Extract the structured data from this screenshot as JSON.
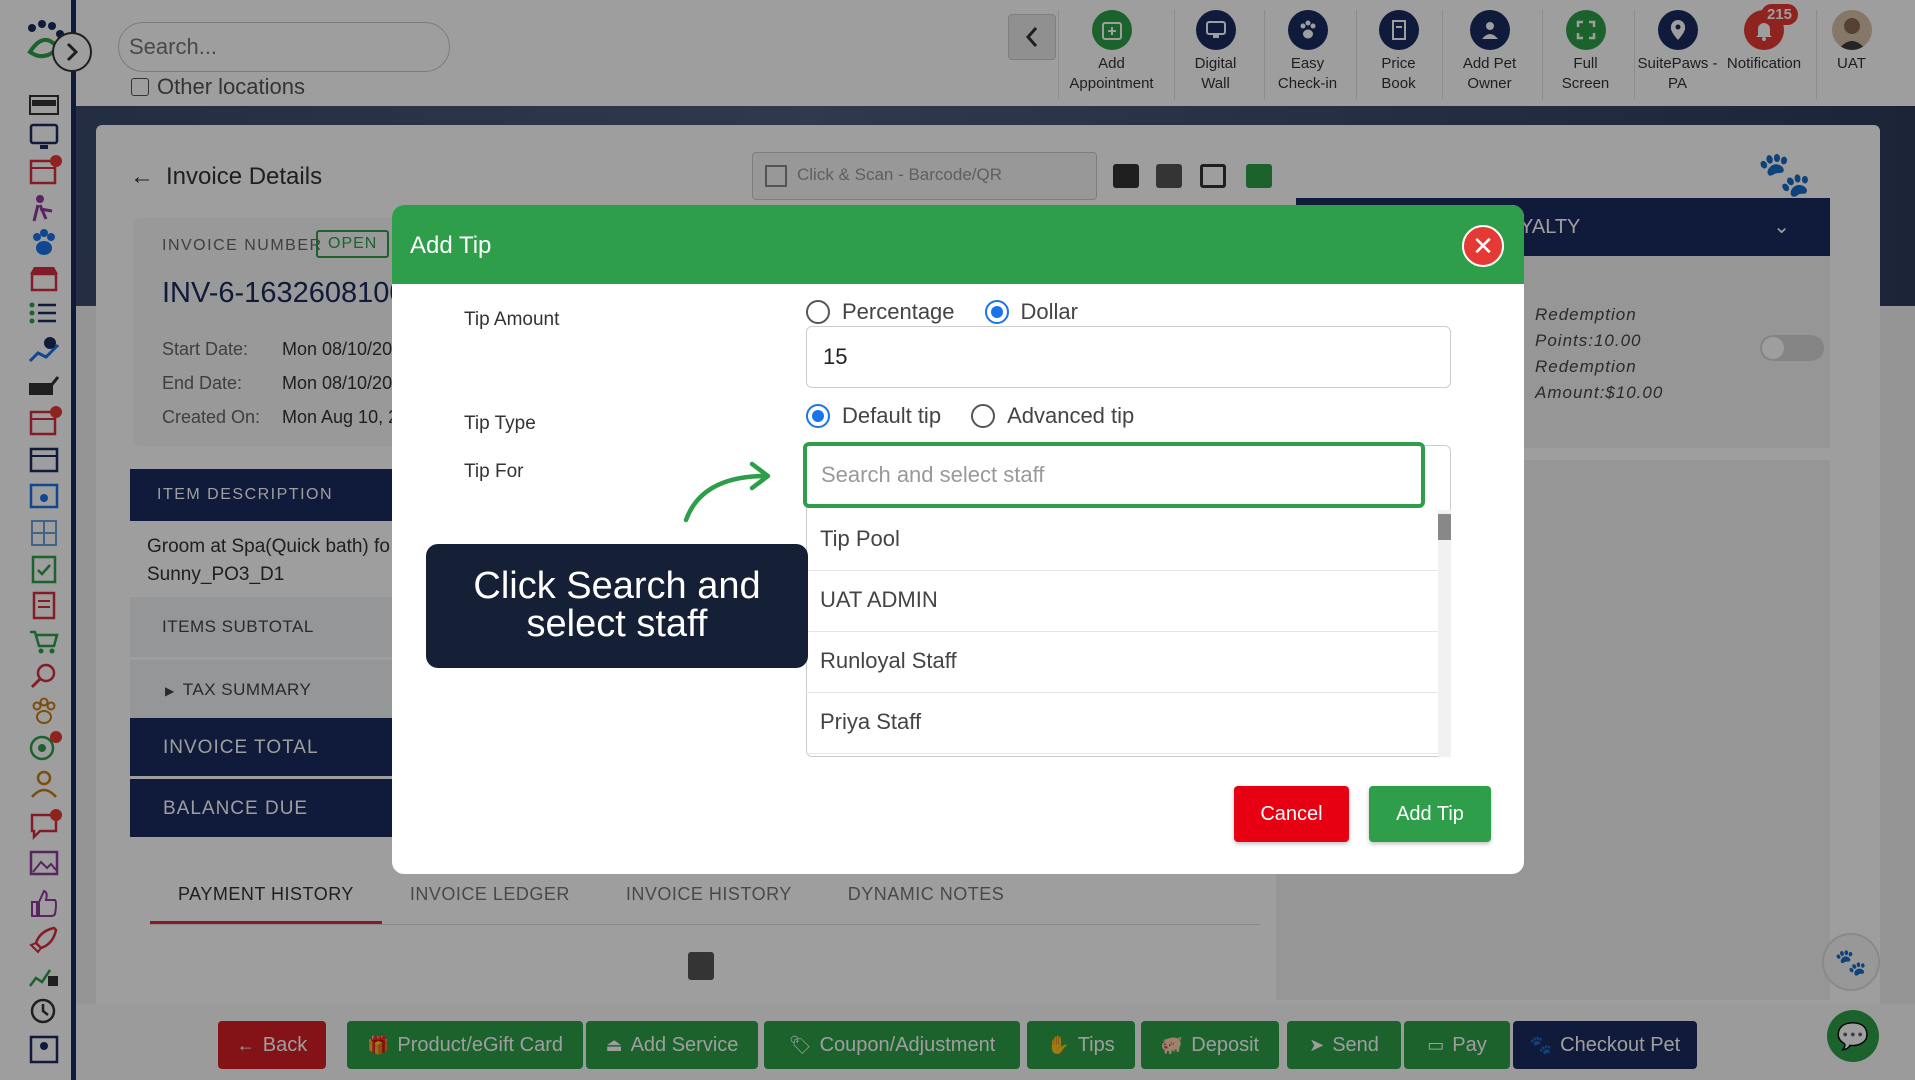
{
  "topbar": {
    "search_placeholder": "Search...",
    "other_locations": "Other locations",
    "tools": [
      {
        "label": "Add Appointment",
        "icon": "calendar-plus-icon",
        "color": "#2e9e4a"
      },
      {
        "label": "Digital Wall",
        "icon": "monitor-icon",
        "color": "#1b2a5e"
      },
      {
        "label": "Easy Check-in",
        "icon": "paw-icon",
        "color": "#1b2a5e"
      },
      {
        "label": "Price Book",
        "icon": "book-icon",
        "color": "#1b2a5e"
      },
      {
        "label": "Add Pet Owner",
        "icon": "add-user-icon",
        "color": "#1b2a5e"
      },
      {
        "label": "Full Screen",
        "icon": "expand-icon",
        "color": "#2e9e4a"
      },
      {
        "label": "SuitePaws - PA",
        "icon": "location-pin-icon",
        "color": "#1b2a5e"
      },
      {
        "label": "Notification",
        "icon": "bell-icon",
        "color": "#e53935"
      },
      {
        "label": "UAT",
        "icon": "avatar-icon",
        "color": "#555555"
      }
    ],
    "notification_count": "215"
  },
  "invoice": {
    "back_title": "Invoice Details",
    "scan_placeholder": "Click & Scan - Barcode/QR",
    "number_label": "INVOICE NUMBER",
    "status": "OPEN",
    "number": "INV-6-1632608100",
    "start_label": "Start Date:",
    "start_value": "Mon 08/10/20",
    "end_label": "End Date:",
    "end_value": "Mon 08/10/20",
    "created_label": "Created On:",
    "created_value": "Mon Aug 10, 2",
    "item_header": "ITEM DESCRIPTION",
    "item_line1": "Groom at Spa(Quick bath) fo",
    "item_line2": "Sunny_PO3_D1",
    "items_subtotal": "ITEMS SUBTOTAL",
    "tax_summary": "TAX SUMMARY",
    "invoice_total": "INVOICE TOTAL",
    "balance_due": "BALANCE DUE"
  },
  "loyalty": {
    "header": "YALTY",
    "line1": "Redemption",
    "line2": "Points:10.00",
    "line3": "Redemption",
    "line4": "Amount:$10.00"
  },
  "tabs": [
    "PAYMENT HISTORY",
    "INVOICE LEDGER",
    "INVOICE HISTORY",
    "DYNAMIC NOTES"
  ],
  "actions": [
    {
      "label": "Back",
      "glyph": "←",
      "style": "red"
    },
    {
      "label": "Product/eGift Card",
      "glyph": "🎁",
      "style": "green"
    },
    {
      "label": "Add Service",
      "glyph": "⏏",
      "style": "green"
    },
    {
      "label": "Coupon/Adjustment",
      "glyph": "🏷",
      "style": "green"
    },
    {
      "label": "Tips",
      "glyph": "✋",
      "style": "green"
    },
    {
      "label": "Deposit",
      "glyph": "🐖",
      "style": "green"
    },
    {
      "label": "Send",
      "glyph": "➤",
      "style": "green"
    },
    {
      "label": "Pay",
      "glyph": "▭",
      "style": "green"
    },
    {
      "label": "Checkout Pet",
      "glyph": "🐾",
      "style": "navy"
    }
  ],
  "modal": {
    "title": "Add Tip",
    "tip_amount_label": "Tip Amount",
    "opt_percentage": "Percentage",
    "opt_dollar": "Dollar",
    "amount_mode": "Dollar",
    "amount_value": "15",
    "tip_type_label": "Tip Type",
    "opt_default": "Default tip",
    "opt_advanced": "Advanced tip",
    "tip_type": "Default tip",
    "tip_for_label": "Tip For",
    "staff_placeholder": "Search and select staff",
    "staff_options": [
      "Tip Pool",
      "UAT ADMIN",
      "Runloyal Staff",
      "Priya Staff"
    ],
    "cancel_label": "Cancel",
    "add_label": "Add Tip"
  },
  "callout": {
    "line1": "Click Search and",
    "line2": "select staff"
  },
  "colors": {
    "brand_green": "#2e9e4a",
    "navy": "#1b2a5e",
    "danger": "#e60012",
    "callout_bg": "#152036"
  }
}
